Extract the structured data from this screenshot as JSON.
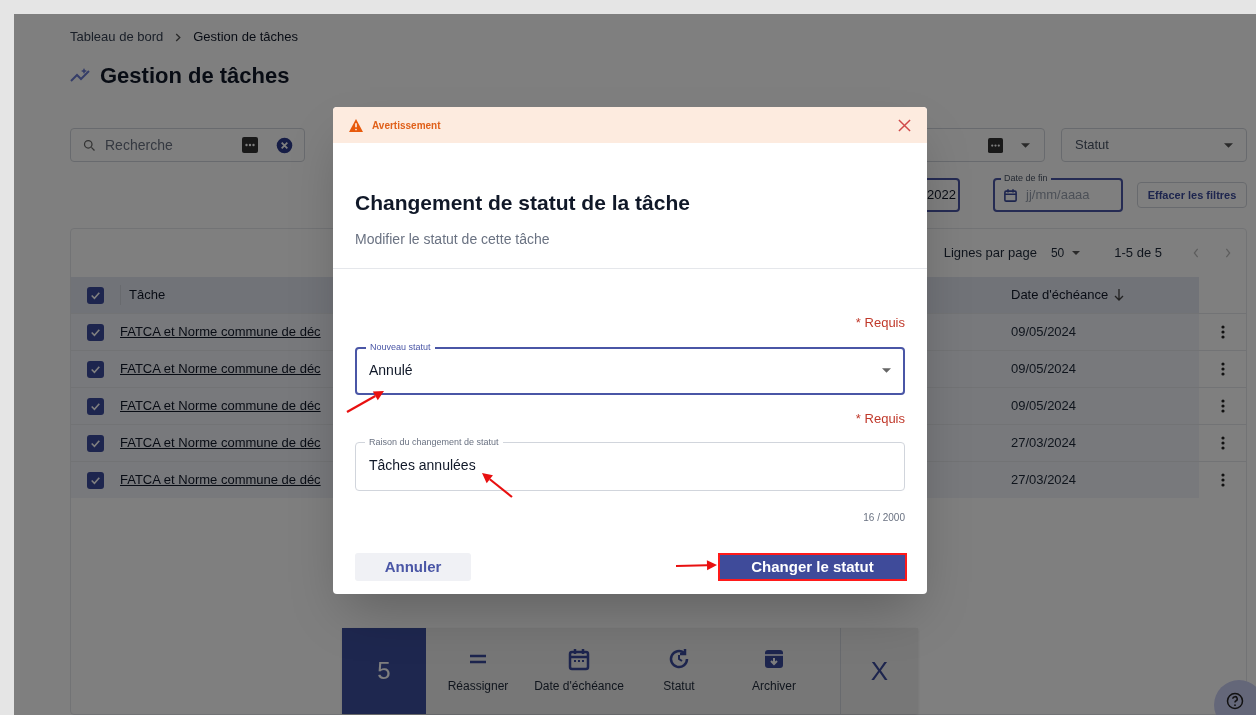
{
  "breadcrumb": [
    {
      "label": "Tableau de bord"
    },
    {
      "label": "Gestion de tâches"
    }
  ],
  "page_title": "Gestion de tâches",
  "search": {
    "placeholder": "Recherche"
  },
  "filters": {
    "status": {
      "placeholder": "Statut"
    },
    "start_date": {
      "value": "2022"
    },
    "end_date": {
      "label": "Date de fin",
      "placeholder": "jj/mm/aaaa"
    },
    "clear_button": "Effacer les filtres"
  },
  "table": {
    "rows_per_page_label": "Lignes par page",
    "rows_per_page": "50",
    "range": "1-5 de 5",
    "header_checked": true,
    "columns": [
      {
        "label": "Tâche",
        "sorted": false
      },
      {
        "label": "Date d'échéance",
        "sorted": true
      }
    ],
    "rows": [
      {
        "checked": true,
        "task": "FATCA et Norme commune de déc",
        "due": "09/05/2024"
      },
      {
        "checked": true,
        "task": "FATCA et Norme commune de déc",
        "due": "09/05/2024"
      },
      {
        "checked": true,
        "task": "FATCA et Norme commune de déc",
        "due": "09/05/2024"
      },
      {
        "checked": true,
        "task": "FATCA et Norme commune de déc",
        "due": "27/03/2024"
      },
      {
        "checked": true,
        "task": "FATCA et Norme commune de déc",
        "due": "27/03/2024"
      }
    ]
  },
  "bulk_bar": {
    "count": "5",
    "actions": [
      {
        "kind": "reassign",
        "label": "Réassigner"
      },
      {
        "kind": "due_date",
        "label": "Date d'échéance"
      },
      {
        "kind": "status",
        "label": "Statut"
      },
      {
        "kind": "archive",
        "label": "Archiver"
      }
    ],
    "close": "X"
  },
  "modal": {
    "banner": "Avertissement",
    "title": "Changement de statut de la tâche",
    "subtitle": "Modifier le statut de cette tâche",
    "status_field": {
      "required": "* Requis",
      "label": "Nouveau statut",
      "value": "Annulé"
    },
    "reason_field": {
      "required": "* Requis",
      "label": "Raison du changement de statut",
      "value": "Tâches annulées",
      "counter": "16 / 2000"
    },
    "cancel_button": "Annuler",
    "confirm_button": "Changer le statut"
  }
}
